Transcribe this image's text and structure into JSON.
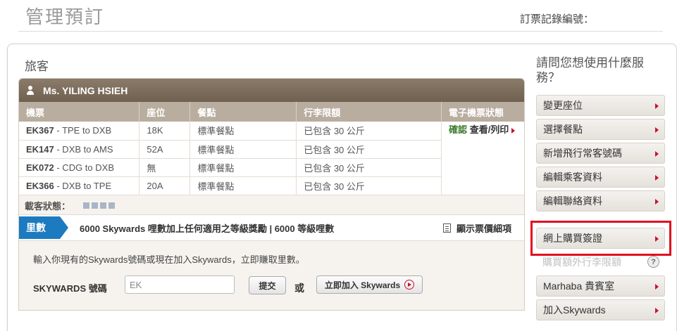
{
  "header": {
    "title": "管理預訂",
    "booking_ref_label": "訂票記錄編號："
  },
  "passengers_section": {
    "title": "旅客",
    "passenger_name": "Ms. YILING HSIEH",
    "columns": [
      "機票",
      "座位",
      "餐點",
      "行李限額",
      "電子機票狀態"
    ],
    "rows": [
      {
        "flight_code": "EK367",
        "route": " - TPE to DXB",
        "seat": "18K",
        "meal": "標準餐點",
        "baggage": "已包含 30 公斤"
      },
      {
        "flight_code": "EK147",
        "route": " - DXB to AMS",
        "seat": "52A",
        "meal": "標準餐點",
        "baggage": "已包含 30 公斤"
      },
      {
        "flight_code": "EK072",
        "route": " - CDG to DXB",
        "seat": "無",
        "meal": "標準餐點",
        "baggage": "已包含 30 公斤"
      },
      {
        "flight_code": "EK366",
        "route": " - DXB to TPE",
        "seat": "20A",
        "meal": "標準餐點",
        "baggage": "已包含 30 公斤"
      }
    ],
    "eticket_status": "確認",
    "eticket_link": "查看/列印",
    "carrier_status_label": "載客狀態：",
    "miles": {
      "tag": "里數",
      "text": "6000 Skywards 哩數加上任何適用之等級獎勵 | 6000 等級哩數",
      "fare_detail_link": "顯示票價細項"
    },
    "skywards": {
      "prompt": "輸入你現有的Skywards號碼或現在加入Skywards，立即賺取里數。",
      "number_label": "SKYWARDS 號碼",
      "input_value": "EK",
      "submit_label": "提交",
      "or_label": "或",
      "join_label": "立即加入 Skywards"
    }
  },
  "services": {
    "question": "請問您想使用什麼服務？",
    "items": [
      {
        "label": "變更座位"
      },
      {
        "label": "選擇餐點"
      },
      {
        "label": "新增飛行常客號碼"
      },
      {
        "label": "編輯乘客資料"
      },
      {
        "label": "編輯聯絡資料"
      },
      {
        "label": "網上購買簽證"
      },
      {
        "label": "購買額外行李限額"
      },
      {
        "label": "Marhaba 貴賓室"
      },
      {
        "label": "加入Skywards"
      }
    ],
    "help_glyph": "?"
  },
  "colors": {
    "accent_red": "#c8102e",
    "header_brown": "#7d6d5d",
    "miles_blue": "#1c7bc0",
    "highlight_red": "#e0101e"
  }
}
